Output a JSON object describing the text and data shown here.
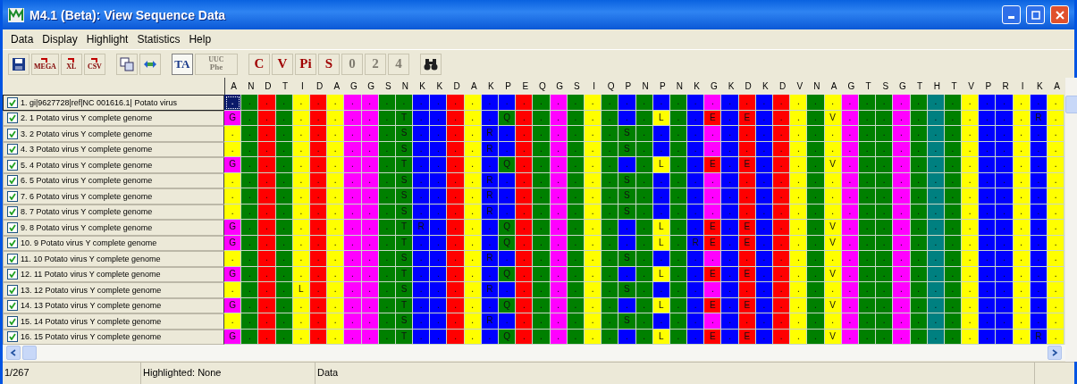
{
  "window": {
    "title": "M4.1 (Beta): View Sequence Data"
  },
  "menu": [
    "Data",
    "Display",
    "Highlight",
    "Statistics",
    "Help"
  ],
  "toolbar": [
    [
      {
        "kind": "save"
      },
      {
        "kind": "export",
        "label": "MEGA"
      },
      {
        "kind": "export",
        "label": "XL"
      },
      {
        "kind": "export",
        "label": "CSV"
      }
    ],
    [
      {
        "kind": "copy"
      },
      {
        "kind": "translate"
      }
    ],
    [
      {
        "kind": "toggle",
        "label": "TA",
        "pressed": true
      },
      {
        "kind": "codon",
        "label": "UUC",
        "sublabel": "Phe",
        "disabled": true
      }
    ],
    [
      {
        "kind": "text",
        "label": "C",
        "disabled": false
      },
      {
        "kind": "text",
        "label": "V",
        "disabled": false
      },
      {
        "kind": "text",
        "label": "Pi",
        "disabled": false
      },
      {
        "kind": "text",
        "label": "S",
        "disabled": false
      },
      {
        "kind": "text",
        "label": "0",
        "disabled": true
      },
      {
        "kind": "text",
        "label": "2",
        "disabled": true
      },
      {
        "kind": "text",
        "label": "4",
        "disabled": true
      }
    ],
    [
      {
        "kind": "find"
      }
    ]
  ],
  "columns": [
    "A",
    "N",
    "D",
    "T",
    "I",
    "D",
    "A",
    "G",
    "G",
    "S",
    "N",
    "K",
    "K",
    "D",
    "A",
    "K",
    "P",
    "E",
    "Q",
    "G",
    "S",
    "I",
    "Q",
    "P",
    "N",
    "P",
    "N",
    "K",
    "G",
    "K",
    "D",
    "K",
    "D",
    "V",
    "N",
    "A",
    "G",
    "T",
    "S",
    "G",
    "T",
    "H",
    "T",
    "V",
    "P",
    "R",
    "I",
    "K",
    "A"
  ],
  "rows": [
    {
      "name": "1. gi|9627728|ref|NC 001616.1| Potato virus",
      "checked": true,
      "focused": true,
      "residues": [
        ".",
        ".",
        ".",
        ".",
        ".",
        ".",
        ".",
        ".",
        ".",
        ".",
        ".",
        ".",
        ".",
        ".",
        ".",
        ".",
        ".",
        ".",
        ".",
        ".",
        ".",
        ".",
        ".",
        ".",
        ".",
        ".",
        ".",
        ".",
        ".",
        ".",
        ".",
        ".",
        ".",
        ".",
        ".",
        ".",
        ".",
        ".",
        ".",
        ".",
        ".",
        ".",
        ".",
        ".",
        ".",
        ".",
        ".",
        ".",
        "."
      ]
    },
    {
      "name": "2. 1 Potato virus Y complete genome",
      "checked": true,
      "focused": false,
      "residues": [
        "G",
        ".",
        ".",
        ".",
        ".",
        ".",
        ".",
        ".",
        ".",
        ".",
        "T",
        ".",
        ".",
        ".",
        ".",
        ".",
        "Q",
        ".",
        ".",
        ".",
        ".",
        ".",
        ".",
        ".",
        ".",
        "L",
        ".",
        ".",
        "E",
        ".",
        "E",
        ".",
        ".",
        ".",
        ".",
        "V",
        ".",
        ".",
        ".",
        ".",
        ".",
        ".",
        ".",
        ".",
        ".",
        ".",
        ".",
        "R",
        "."
      ]
    },
    {
      "name": "3. 2 Potato virus Y complete genome",
      "checked": true,
      "focused": false,
      "residues": [
        ".",
        ".",
        ".",
        ".",
        ".",
        ".",
        ".",
        ".",
        ".",
        ".",
        "S",
        ".",
        ".",
        ".",
        ".",
        "R",
        ".",
        ".",
        ".",
        ".",
        ".",
        ".",
        ".",
        "S",
        ".",
        ".",
        ".",
        ".",
        ".",
        ".",
        ".",
        ".",
        ".",
        ".",
        ".",
        ".",
        ".",
        ".",
        ".",
        ".",
        ".",
        ".",
        ".",
        ".",
        ".",
        ".",
        ".",
        ".",
        "."
      ]
    },
    {
      "name": "4. 3 Potato virus Y complete genome",
      "checked": true,
      "focused": false,
      "residues": [
        ".",
        ".",
        ".",
        ".",
        ".",
        ".",
        ".",
        ".",
        ".",
        ".",
        "S",
        ".",
        ".",
        ".",
        ".",
        "R",
        ".",
        ".",
        ".",
        ".",
        ".",
        ".",
        ".",
        "S",
        ".",
        ".",
        ".",
        ".",
        ".",
        ".",
        ".",
        ".",
        ".",
        ".",
        ".",
        ".",
        ".",
        ".",
        ".",
        ".",
        ".",
        ".",
        ".",
        ".",
        ".",
        ".",
        ".",
        ".",
        "."
      ]
    },
    {
      "name": "5. 4 Potato virus Y complete genome",
      "checked": true,
      "focused": false,
      "residues": [
        "G",
        ".",
        ".",
        ".",
        ".",
        ".",
        ".",
        ".",
        ".",
        ".",
        "T",
        ".",
        ".",
        ".",
        ".",
        ".",
        "Q",
        ".",
        ".",
        ".",
        ".",
        ".",
        ".",
        ".",
        ".",
        "L",
        ".",
        ".",
        "E",
        ".",
        "E",
        ".",
        ".",
        ".",
        ".",
        "V",
        ".",
        ".",
        ".",
        ".",
        ".",
        ".",
        ".",
        ".",
        ".",
        ".",
        ".",
        ".",
        "."
      ]
    },
    {
      "name": "6. 5 Potato virus Y complete genome",
      "checked": true,
      "focused": false,
      "residues": [
        ".",
        ".",
        ".",
        ".",
        ".",
        ".",
        ".",
        ".",
        ".",
        ".",
        "S",
        ".",
        ".",
        ".",
        ".",
        "R",
        ".",
        ".",
        ".",
        ".",
        ".",
        ".",
        ".",
        "S",
        ".",
        ".",
        ".",
        ".",
        ".",
        ".",
        ".",
        ".",
        ".",
        ".",
        ".",
        ".",
        ".",
        ".",
        ".",
        ".",
        ".",
        ".",
        ".",
        ".",
        ".",
        ".",
        ".",
        ".",
        "."
      ]
    },
    {
      "name": "7. 6 Potato virus Y complete genome",
      "checked": true,
      "focused": false,
      "residues": [
        ".",
        ".",
        ".",
        ".",
        ".",
        ".",
        ".",
        ".",
        ".",
        ".",
        "S",
        ".",
        ".",
        ".",
        ".",
        "R",
        ".",
        ".",
        ".",
        ".",
        ".",
        ".",
        ".",
        "S",
        ".",
        ".",
        ".",
        ".",
        ".",
        ".",
        ".",
        ".",
        ".",
        ".",
        ".",
        ".",
        ".",
        ".",
        ".",
        ".",
        ".",
        ".",
        ".",
        ".",
        ".",
        ".",
        ".",
        ".",
        "."
      ]
    },
    {
      "name": "8. 7 Potato virus Y complete genome",
      "checked": true,
      "focused": false,
      "residues": [
        ".",
        ".",
        ".",
        ".",
        ".",
        ".",
        ".",
        ".",
        ".",
        ".",
        "S",
        ".",
        ".",
        ".",
        ".",
        "R",
        ".",
        ".",
        ".",
        ".",
        ".",
        ".",
        ".",
        "S",
        ".",
        ".",
        ".",
        ".",
        ".",
        ".",
        ".",
        ".",
        ".",
        ".",
        ".",
        ".",
        ".",
        ".",
        ".",
        ".",
        ".",
        ".",
        ".",
        ".",
        ".",
        ".",
        ".",
        ".",
        "."
      ]
    },
    {
      "name": "9. 8 Potato virus Y complete genome",
      "checked": true,
      "focused": false,
      "residues": [
        "G",
        ".",
        ".",
        ".",
        ".",
        ".",
        ".",
        ".",
        ".",
        ".",
        "T",
        "R",
        ".",
        ".",
        ".",
        ".",
        "Q",
        ".",
        ".",
        ".",
        ".",
        ".",
        ".",
        ".",
        ".",
        "L",
        ".",
        ".",
        "E",
        ".",
        "E",
        ".",
        ".",
        ".",
        ".",
        "V",
        ".",
        ".",
        ".",
        ".",
        ".",
        ".",
        ".",
        ".",
        ".",
        ".",
        ".",
        ".",
        "."
      ]
    },
    {
      "name": "10. 9 Potato virus Y complete genome",
      "checked": true,
      "focused": false,
      "residues": [
        "G",
        ".",
        ".",
        ".",
        ".",
        ".",
        ".",
        ".",
        ".",
        ".",
        "T",
        ".",
        ".",
        ".",
        ".",
        ".",
        "Q",
        ".",
        ".",
        ".",
        ".",
        ".",
        ".",
        ".",
        ".",
        "L",
        ".",
        "R",
        "E",
        ".",
        "E",
        ".",
        ".",
        ".",
        ".",
        "V",
        ".",
        ".",
        ".",
        ".",
        ".",
        ".",
        ".",
        ".",
        ".",
        ".",
        ".",
        ".",
        "."
      ]
    },
    {
      "name": "11. 10 Potato virus Y complete genome",
      "checked": true,
      "focused": false,
      "residues": [
        ".",
        ".",
        ".",
        ".",
        ".",
        ".",
        ".",
        ".",
        ".",
        ".",
        "S",
        ".",
        ".",
        ".",
        ".",
        "R",
        ".",
        ".",
        ".",
        ".",
        ".",
        ".",
        ".",
        "S",
        ".",
        ".",
        ".",
        ".",
        ".",
        ".",
        ".",
        ".",
        ".",
        ".",
        ".",
        ".",
        ".",
        ".",
        ".",
        ".",
        ".",
        ".",
        ".",
        ".",
        ".",
        ".",
        ".",
        ".",
        "."
      ]
    },
    {
      "name": "12. 11 Potato virus Y complete genome",
      "checked": true,
      "focused": false,
      "residues": [
        "G",
        ".",
        ".",
        ".",
        ".",
        ".",
        ".",
        ".",
        ".",
        ".",
        "T",
        ".",
        ".",
        ".",
        ".",
        ".",
        "Q",
        ".",
        ".",
        ".",
        ".",
        ".",
        ".",
        ".",
        ".",
        "L",
        ".",
        ".",
        "E",
        ".",
        "E",
        ".",
        ".",
        ".",
        ".",
        "V",
        ".",
        ".",
        ".",
        ".",
        ".",
        ".",
        ".",
        ".",
        ".",
        ".",
        ".",
        ".",
        "."
      ]
    },
    {
      "name": "13. 12 Potato virus Y complete genome",
      "checked": true,
      "focused": false,
      "residues": [
        ".",
        ".",
        ".",
        ".",
        "L",
        ".",
        ".",
        ".",
        ".",
        ".",
        "S",
        ".",
        ".",
        ".",
        ".",
        "R",
        ".",
        ".",
        ".",
        ".",
        ".",
        ".",
        ".",
        "S",
        ".",
        ".",
        ".",
        ".",
        ".",
        ".",
        ".",
        ".",
        ".",
        ".",
        ".",
        ".",
        ".",
        ".",
        ".",
        ".",
        ".",
        ".",
        ".",
        ".",
        ".",
        ".",
        ".",
        ".",
        "."
      ]
    },
    {
      "name": "14. 13 Potato virus Y complete genome",
      "checked": true,
      "focused": false,
      "residues": [
        "G",
        ".",
        ".",
        ".",
        ".",
        ".",
        ".",
        ".",
        ".",
        ".",
        "T",
        ".",
        ".",
        ".",
        ".",
        ".",
        "Q",
        ".",
        ".",
        ".",
        ".",
        ".",
        ".",
        ".",
        ".",
        "L",
        ".",
        ".",
        "E",
        ".",
        "E",
        ".",
        ".",
        ".",
        ".",
        "V",
        ".",
        ".",
        ".",
        ".",
        ".",
        ".",
        ".",
        ".",
        ".",
        ".",
        ".",
        ".",
        "."
      ]
    },
    {
      "name": "15. 14 Potato virus Y complete genome",
      "checked": true,
      "focused": false,
      "residues": [
        ".",
        ".",
        ".",
        ".",
        ".",
        ".",
        ".",
        ".",
        ".",
        ".",
        "S",
        ".",
        ".",
        ".",
        ".",
        "R",
        ".",
        ".",
        ".",
        ".",
        ".",
        ".",
        ".",
        "S",
        ".",
        ".",
        ".",
        ".",
        ".",
        ".",
        ".",
        ".",
        ".",
        ".",
        ".",
        ".",
        ".",
        ".",
        ".",
        ".",
        ".",
        ".",
        ".",
        ".",
        ".",
        ".",
        ".",
        ".",
        "."
      ]
    },
    {
      "name": "16. 15 Potato virus Y complete genome",
      "checked": true,
      "focused": false,
      "residues": [
        "G",
        ".",
        ".",
        ".",
        ".",
        ".",
        ".",
        ".",
        ".",
        ".",
        "T",
        ".",
        ".",
        ".",
        ".",
        ".",
        "Q",
        ".",
        ".",
        ".",
        ".",
        ".",
        ".",
        ".",
        ".",
        "L",
        ".",
        ".",
        "E",
        ".",
        "E",
        ".",
        ".",
        ".",
        ".",
        "V",
        ".",
        ".",
        ".",
        ".",
        ".",
        ".",
        ".",
        ".",
        ".",
        ".",
        ".",
        "R",
        "."
      ]
    }
  ],
  "status_bar": [
    "1/267",
    "Highlighted: None",
    "Data"
  ]
}
